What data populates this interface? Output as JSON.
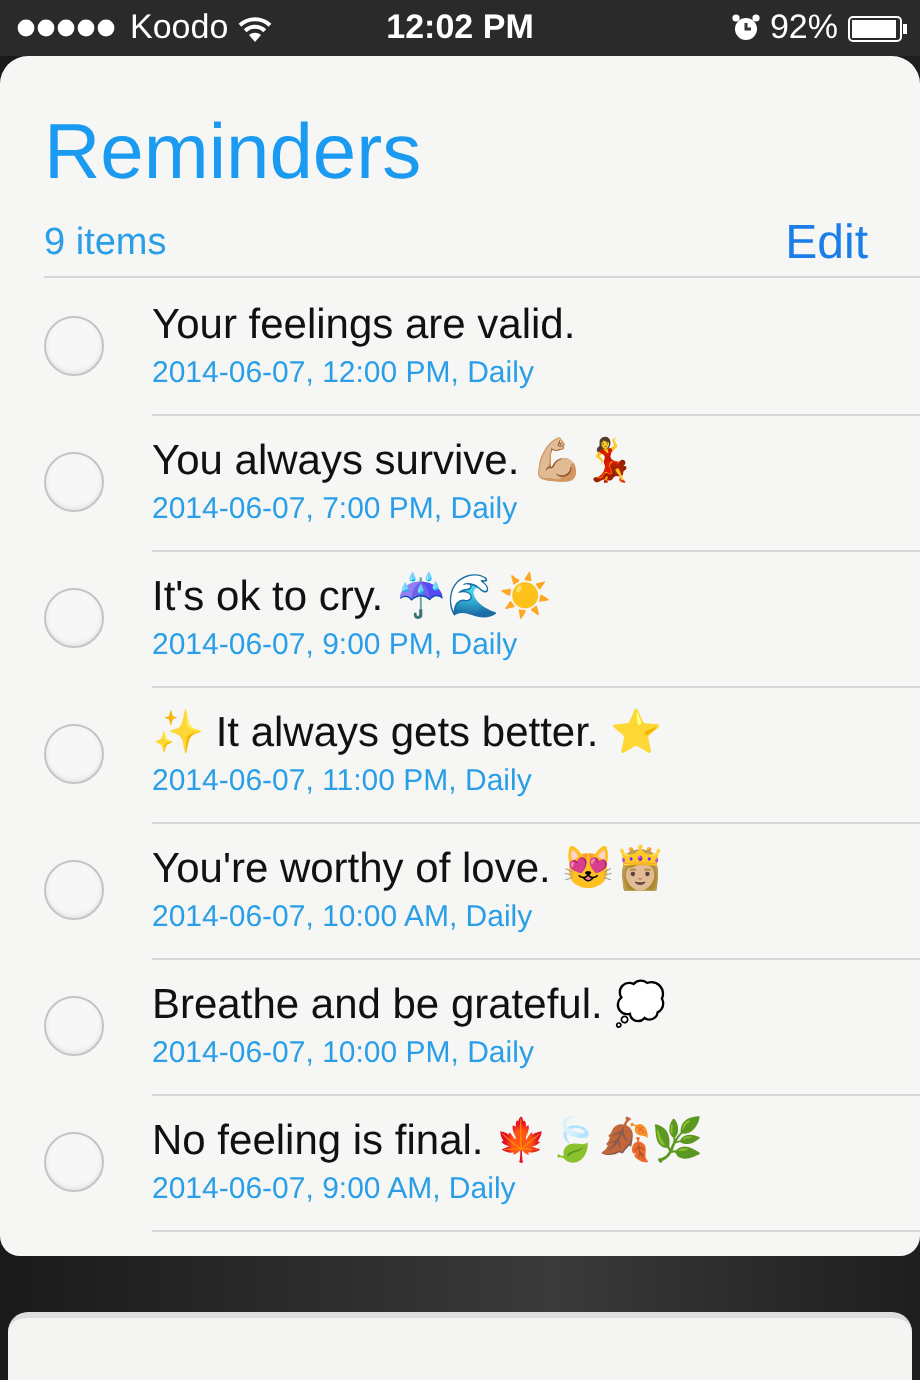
{
  "status_bar": {
    "carrier": "Koodo",
    "time": "12:02 PM",
    "battery": "92%"
  },
  "list": {
    "title": "Reminders",
    "count": "9 items",
    "edit": "Edit"
  },
  "reminders": [
    {
      "title": "Your feelings are valid.",
      "detail": "2014-06-07, 12:00 PM, Daily",
      "completed": false
    },
    {
      "title": "You always survive. 💪🏼💃",
      "detail": "2014-06-07, 7:00 PM, Daily",
      "completed": false
    },
    {
      "title": "It's ok to cry. ☔🌊☀️",
      "detail": "2014-06-07, 9:00 PM, Daily",
      "completed": false
    },
    {
      "title": "✨ It always gets better. ⭐",
      "detail": "2014-06-07, 11:00 PM, Daily",
      "completed": false
    },
    {
      "title": "You're worthy of love. 😻👸🏼",
      "detail": "2014-06-07, 10:00 AM, Daily",
      "completed": false
    },
    {
      "title": "Breathe and be grateful. 💭",
      "detail": "2014-06-07, 10:00 PM, Daily",
      "completed": false
    },
    {
      "title": "No feeling is final. 🍁🍃🍂🌿",
      "detail": "2014-06-07, 9:00 AM, Daily",
      "completed": false
    }
  ]
}
